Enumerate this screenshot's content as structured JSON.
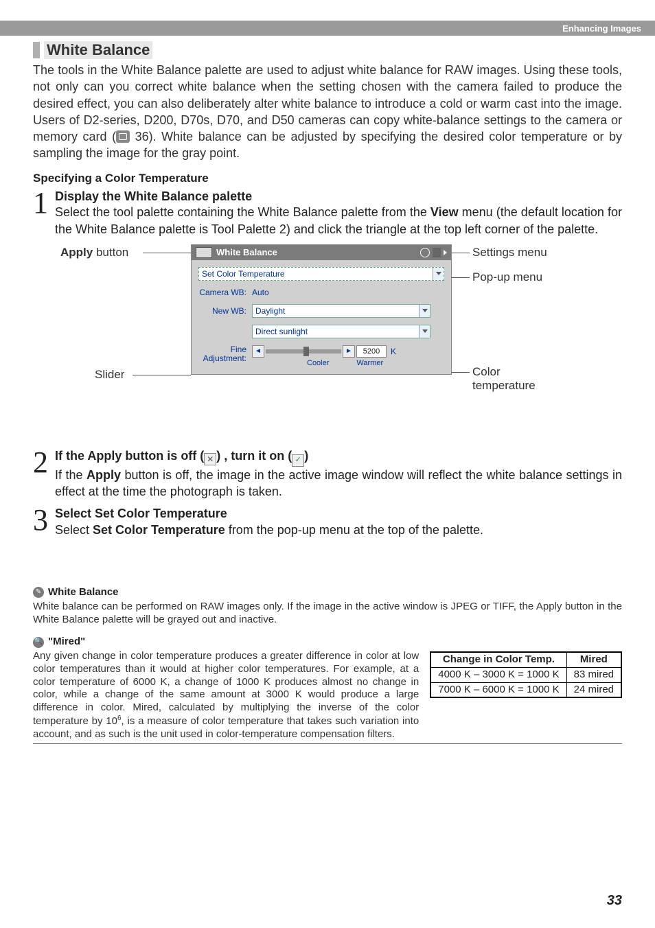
{
  "header": {
    "breadcrumb": "Enhancing Images"
  },
  "section": {
    "title": "White Balance",
    "intro": "The tools in the White Balance palette are used to adjust white balance for RAW images.  Using these tools, not only can you correct white balance when the setting chosen with the camera failed to produce the desired effect, you can also deliberately alter white balance to introduce a cold or warm cast into the image.  Users of D2-series, D200, D70s, D70, and D50 cameras can copy white-balance settings to the camera or memory card (",
    "intro_page_ref": " 36).  White balance can be adjusted by specifying the desired color temperature or by sampling the image for the gray point.",
    "sub_heading": "Specifying a Color Temperature"
  },
  "steps": {
    "s1": {
      "num": "1",
      "title": "Display the White Balance palette",
      "text_a": "Select the tool palette containing the White Balance palette from the ",
      "text_bold": "View",
      "text_b": " menu (the default location for the White Balance palette is Tool Palette 2) and click the triangle at the top left corner of the palette."
    },
    "s2": {
      "num": "2",
      "title_a": "If the Apply button is off (",
      "title_b": ") , turn it on (",
      "title_c": ")",
      "text_a": "If the ",
      "text_bold": "Apply",
      "text_b": " button is off, the image in the active image window will reflect the white balance settings in effect at the time the photograph is taken."
    },
    "s3": {
      "num": "3",
      "title_a": "Select ",
      "title_bold": "Set Color Temperature",
      "text_a": "Select ",
      "text_bold": "Set Color Temperature",
      "text_b": " from the pop-up menu at the top of the palette."
    }
  },
  "diagram": {
    "labels": {
      "apply": "Apply",
      "apply_suffix": " button",
      "slider": "Slider",
      "settings": "Settings menu",
      "popup": "Pop-up menu",
      "color_temp_a": "Color",
      "color_temp_b": "temperature"
    },
    "palette": {
      "title": "White Balance",
      "mode": "Set Color Temperature",
      "camera_wb_label": "Camera WB:",
      "camera_wb_value": "Auto",
      "new_wb_label": "New WB:",
      "new_wb_value": "Daylight",
      "sub_value": "Direct sunlight",
      "fine_label_a": "Fine",
      "fine_label_b": "Adjustment:",
      "cooler": "Cooler",
      "warmer": "Warmer",
      "kelvin": "5200",
      "k": "K"
    }
  },
  "notes": {
    "wb": {
      "title": "White Balance",
      "text": "White balance can be performed on RAW images only.  If the image in the active window is JPEG or TIFF, the Apply button in the White Balance palette will be grayed out and inactive."
    },
    "mired": {
      "title": "\"Mired\"",
      "text_a": "Any given change in color temperature produces a greater difference in color at low color temperatures than it would at higher color temperatures.  For example, at a color temperature of 6000 K, a change of 1000 K produces almost no change in color, while a change of the same amount at 3000 K would produce a large difference in color.  Mired, calculated by multiplying the inverse of the color temperature by 10",
      "text_b": ", is a measure of color temperature that takes such variation into account, and as such is the unit used in color-temperature compensation filters.",
      "table": {
        "h1": "Change in Color Temp.",
        "h2": "Mired",
        "r1c1": "4000 K – 3000 K = 1000 K",
        "r1c2": "83 mired",
        "r2c1": "7000 K – 6000 K = 1000 K",
        "r2c2": "24 mired"
      }
    }
  },
  "page_number": "33"
}
